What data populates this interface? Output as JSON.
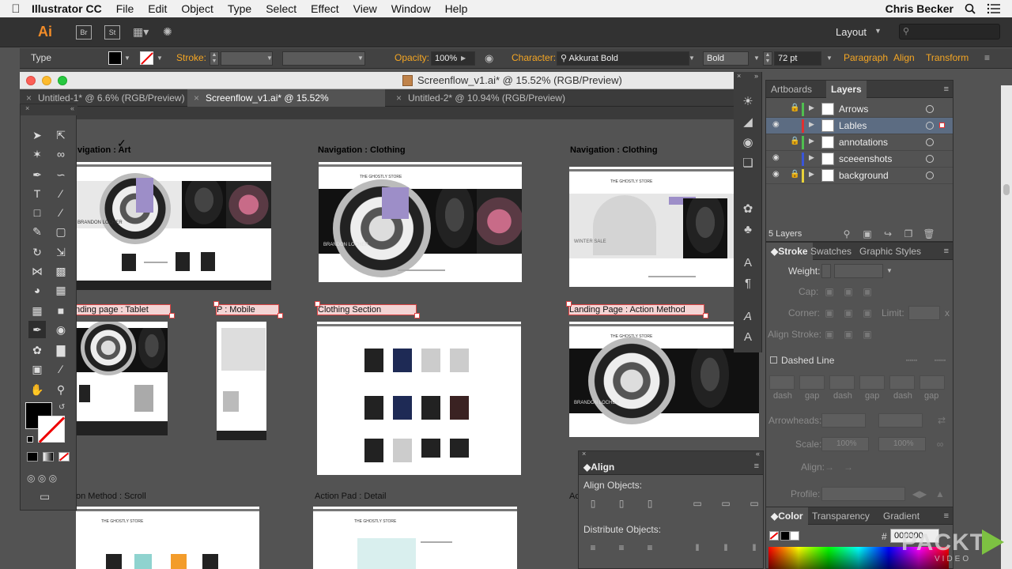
{
  "menubar": {
    "app_name": "Illustrator CC",
    "items": [
      "File",
      "Edit",
      "Object",
      "Type",
      "Select",
      "Effect",
      "View",
      "Window",
      "Help"
    ],
    "user": "Chris Becker"
  },
  "appbar": {
    "logo": "Ai",
    "bridge": "Br",
    "stock": "St",
    "workspace": "Layout"
  },
  "control": {
    "selection_type": "Type",
    "stroke_label": "Stroke:",
    "opacity_label": "Opacity:",
    "opacity_value": "100%",
    "character_label": "Character:",
    "font_family": "Akkurat Bold",
    "font_style": "Bold",
    "font_size": "72 pt",
    "paragraph_link": "Paragraph",
    "align_link": "Align",
    "transform_link": "Transform"
  },
  "document": {
    "title": "Screenflow_v1.ai* @ 15.52% (RGB/Preview)",
    "tabs": [
      {
        "label": "Untitled-1* @ 6.6% (RGB/Preview)"
      },
      {
        "label": "Screenflow_v1.ai* @ 15.52% (RGB/Preview)"
      },
      {
        "label": "Untitled-2* @ 10.94% (RGB/Preview)"
      }
    ]
  },
  "artboards": {
    "row1": [
      "vigation : Art",
      "Navigation : Clothing",
      "Navigation : Clothing"
    ],
    "row2": [
      "nding page : Tablet",
      "P : Mobile",
      "Clothing Section",
      "Landing Page : Action Method"
    ],
    "row3": [
      "on Method : Scroll",
      "Action Pad : Detail",
      "Ac"
    ],
    "mock_texts": {
      "brand": "BRANDON LOCHER",
      "winter": "WINTER SALE",
      "store": "THE GHOSTLY STORE"
    }
  },
  "layers_panel": {
    "tabs": [
      "Artboards",
      "Layers"
    ],
    "layers": [
      {
        "name": "Arrows",
        "color": "#4fbf4f"
      },
      {
        "name": "Lables",
        "color": "#e03030"
      },
      {
        "name": "annotations",
        "color": "#4fbf4f"
      },
      {
        "name": "sceeenshots",
        "color": "#3a55d8"
      },
      {
        "name": "background",
        "color": "#e8d23a"
      }
    ],
    "count": "5 Layers"
  },
  "stroke_panel": {
    "tabs": [
      "Stroke",
      "Swatches",
      "Graphic Styles"
    ],
    "weight_label": "Weight:",
    "cap_label": "Cap:",
    "corner_label": "Corner:",
    "limit_label": "Limit:",
    "limit_unit": "x",
    "align_stroke_label": "Align Stroke:",
    "dashed_line_label": "Dashed Line",
    "dash_labels": [
      "dash",
      "gap",
      "dash",
      "gap",
      "dash",
      "gap"
    ],
    "arrowheads_label": "Arrowheads:",
    "scale_label": "Scale:",
    "scale_value_1": "100%",
    "scale_value_2": "100%",
    "align_label": "Align:",
    "profile_label": "Profile:"
  },
  "color_panel": {
    "tabs": [
      "Color",
      "Transparency",
      "Gradient"
    ],
    "hash": "#",
    "hex_value": "000000"
  },
  "align_panel": {
    "title": "Align",
    "align_objects_label": "Align Objects:",
    "distribute_objects_label": "Distribute Objects:"
  },
  "watermark": {
    "text": "PACKT",
    "sub": "VIDEO"
  },
  "colors": {
    "accent": "#f5a623",
    "selection_red": "#dd4444",
    "panel_bg": "#535353"
  }
}
